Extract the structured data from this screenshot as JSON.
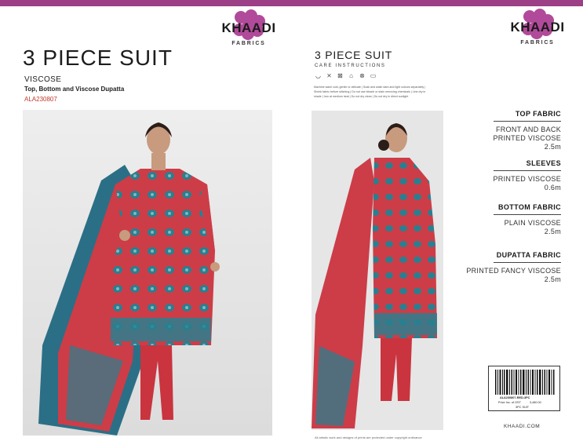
{
  "brand": {
    "name": "KHAADI",
    "sub": "FABRICS",
    "accent": "#9c3f86",
    "logo_color": "#b14a9a"
  },
  "left": {
    "title": "3 PIECE SUIT",
    "fabric": "VISCOSE",
    "description": "Top, Bottom and Viscose  Dupatta",
    "code": "ALA230807"
  },
  "middle": {
    "title": "3 PIECE SUIT",
    "care_title": "CARE INSTRUCTIONS",
    "care_icons": [
      "wash-icon",
      "no-bleach-icon",
      "no-tumble-dry-icon",
      "iron-icon",
      "no-dry-clean-icon",
      "shade-dry-icon"
    ],
    "care_text": "Machine wash cold, gentle or delicate | Soak and wash dark and light colours separately | Shrink fabric before stitching | Do not use bleach or stain removing chemicals | Line dry in shade | Iron at medium heat | Do not dry clean | Do not dry in direct sunlight",
    "footnote": "All artistic work and designs of prints are protected under copyright ordinance"
  },
  "specs": [
    {
      "heading": "TOP FABRIC",
      "lines": [
        "FRONT AND BACK",
        "PRINTED VISCOSE",
        "2.5m"
      ]
    },
    {
      "heading": "SLEEVES",
      "lines": [
        "PRINTED VISCOSE",
        "0.6m"
      ]
    },
    {
      "heading": "BOTTOM FABRIC",
      "lines": [
        "PLAIN VISCOSE",
        "2.5m"
      ]
    },
    {
      "heading": "DUPATTA FABRIC",
      "lines": [
        "PRINTED FANCY VISCOSE",
        "2.5m"
      ]
    }
  ],
  "tag": {
    "code": "ALA230807-RED-3PC",
    "price_label": "Price Inc. of GST",
    "price": "3,480.00",
    "type": "3PC SUIT"
  },
  "website": "KHAADI.COM",
  "colors": {
    "suit_red": "#cc3d48",
    "motif_teal": "#2a7f8f",
    "background_grey": "#e8e8e8"
  }
}
